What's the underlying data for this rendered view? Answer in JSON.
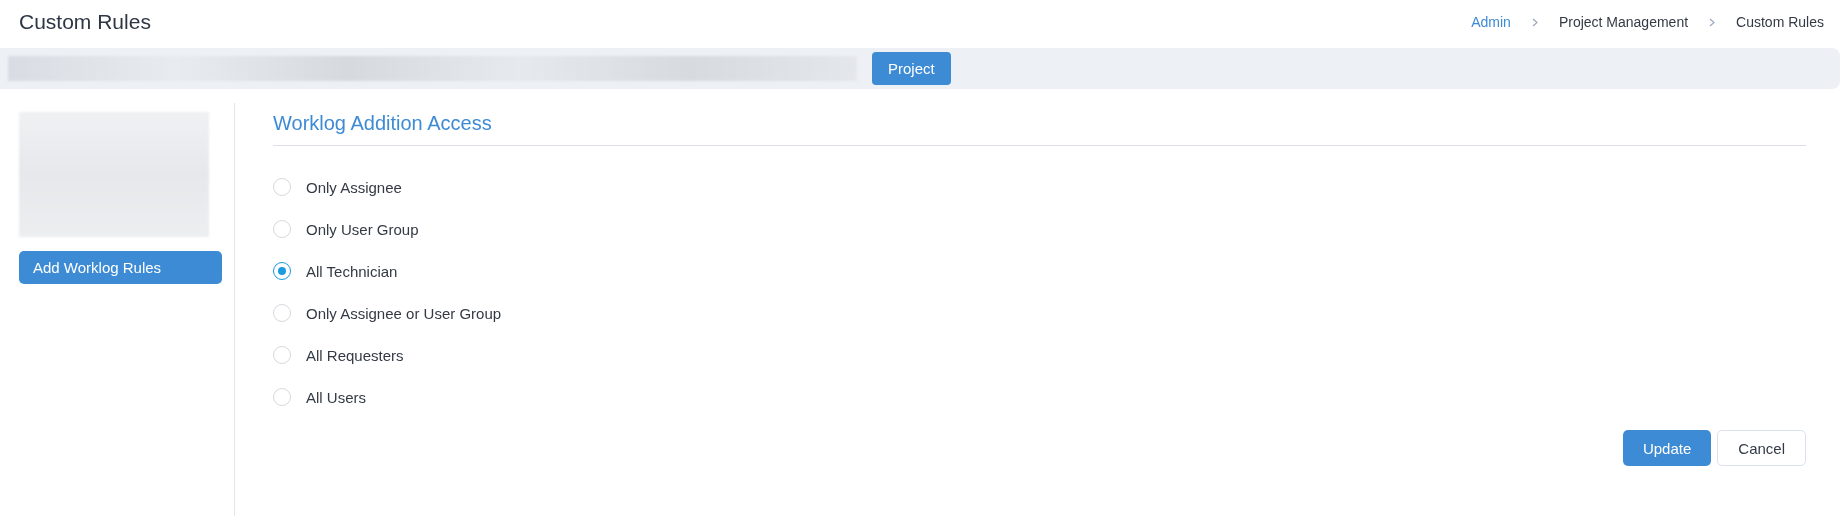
{
  "page_title": "Custom Rules",
  "breadcrumb": [
    {
      "label": "Admin",
      "link": true
    },
    {
      "label": "Project Management",
      "link": false
    },
    {
      "label": "Custom Rules",
      "link": false
    }
  ],
  "toolbar": {
    "tabs": [
      {
        "label": "Project",
        "selected": true
      }
    ]
  },
  "sidebar": {
    "button": "Add Worklog Rules"
  },
  "section": {
    "title": "Worklog Addition Access",
    "options": [
      {
        "label": "Only Assignee",
        "selected": false
      },
      {
        "label": "Only User Group",
        "selected": false
      },
      {
        "label": "All Technician",
        "selected": true
      },
      {
        "label": "Only Assignee or User Group",
        "selected": false
      },
      {
        "label": "All Requesters",
        "selected": false
      },
      {
        "label": "All Users",
        "selected": false
      }
    ]
  },
  "buttons": [
    {
      "label": "Update",
      "kind": "primary"
    },
    {
      "label": "Cancel",
      "kind": "secondary"
    }
  ]
}
